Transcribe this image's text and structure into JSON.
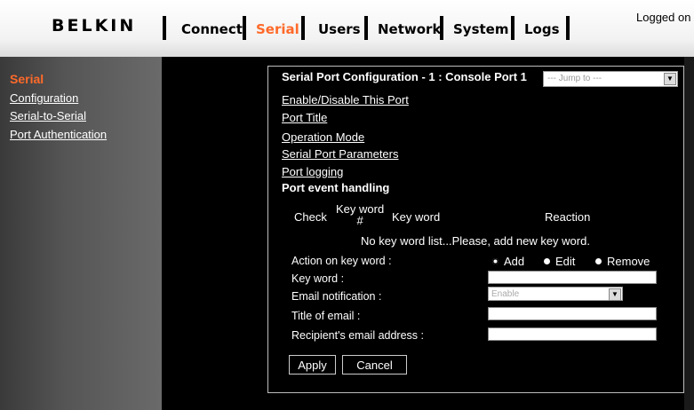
{
  "header": {
    "brand": "BELKIN",
    "tabs": [
      {
        "label": "Connect"
      },
      {
        "label": "Serial"
      },
      {
        "label": "Users"
      },
      {
        "label": "Network"
      },
      {
        "label": "System"
      },
      {
        "label": "Logs"
      }
    ],
    "active_tab": "Serial",
    "logged_text": "Logged on",
    "accent_color": "#ff6a2a"
  },
  "sidebar": {
    "heading": "Serial",
    "items": [
      {
        "label": "Configuration"
      },
      {
        "label": "Serial-to-Serial"
      },
      {
        "label": "Port Authentication"
      }
    ]
  },
  "panel": {
    "title": "Serial Port Configuration - 1 : Console Port 1",
    "jump_placeholder": "--- Jump to ---",
    "links": [
      {
        "label": "Enable/Disable This Port"
      },
      {
        "label": "Port Title"
      },
      {
        "label": "Operation Mode"
      },
      {
        "label": "Serial Port Parameters"
      },
      {
        "label": "Port logging"
      }
    ],
    "section_title": "Port event handling",
    "columns": {
      "check": "Check",
      "keyword_num_line1": "Key word",
      "keyword_num_line2": "#",
      "keyword": "Key word",
      "reaction": "Reaction"
    },
    "empty_message": "No key word list...Please, add new key word.",
    "form": {
      "action_label": "Action on key word :",
      "actions": [
        {
          "label": "Add",
          "selected": true
        },
        {
          "label": "Edit",
          "selected": false
        },
        {
          "label": "Remove",
          "selected": false
        }
      ],
      "keyword_label": "Key word :",
      "keyword_value": "",
      "email_notification_label": "Email notification :",
      "email_notification_value": "Enable",
      "title_of_email_label": "Title of email :",
      "title_of_email_value": "",
      "recipient_label": "Recipient's email address :",
      "recipient_value": ""
    },
    "buttons": {
      "apply": "Apply",
      "cancel": "Cancel"
    }
  }
}
